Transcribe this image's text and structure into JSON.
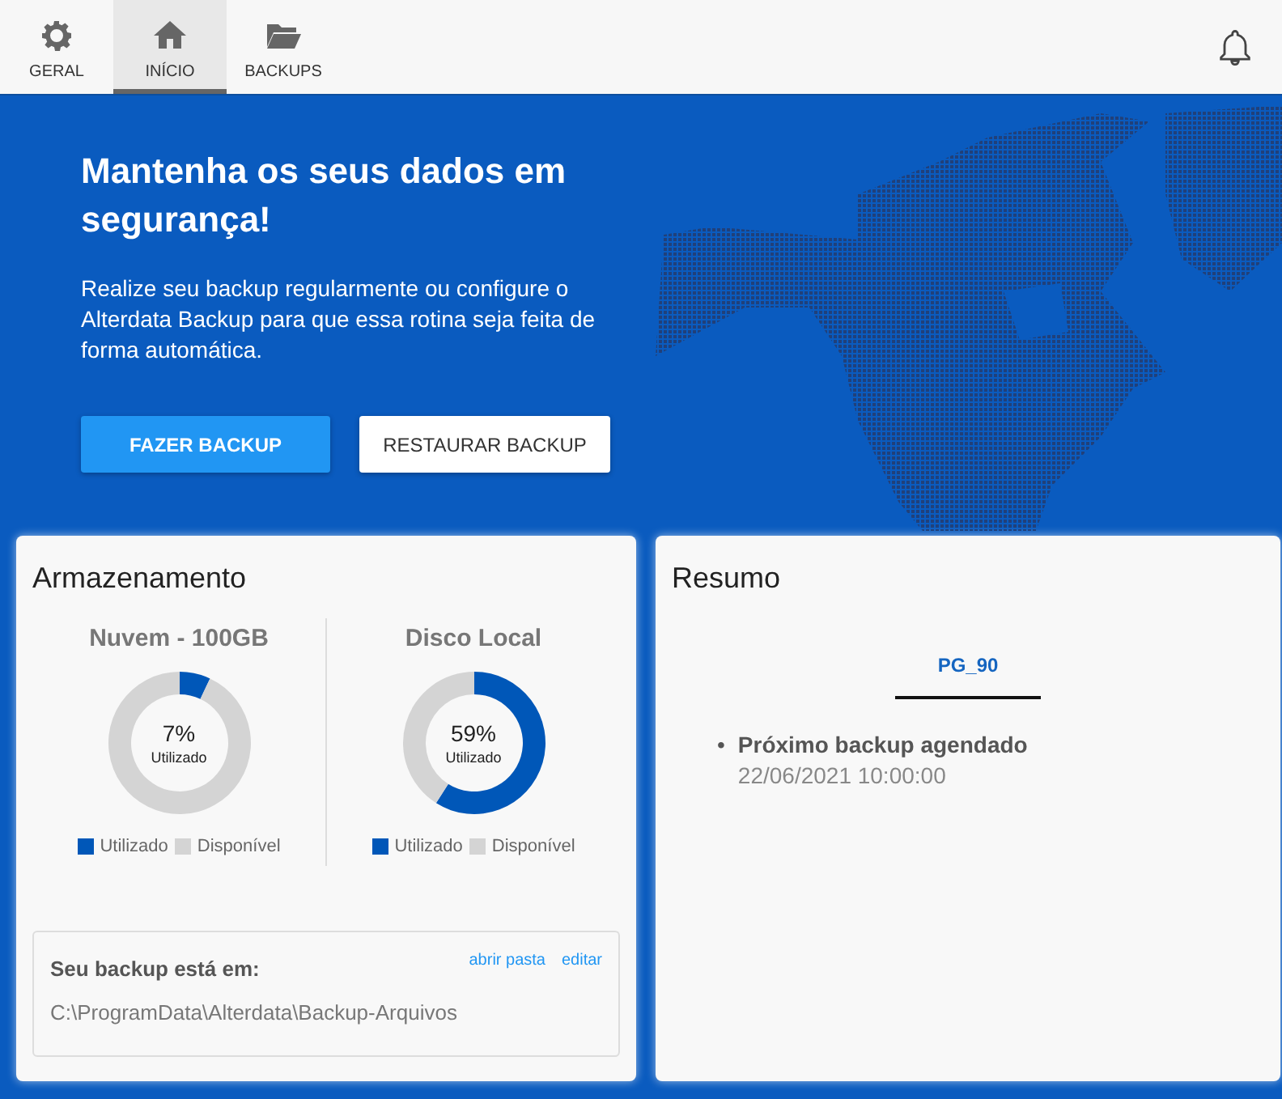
{
  "tabs": [
    {
      "label": "GERAL",
      "selected": false
    },
    {
      "label": "INÍCIO",
      "selected": true
    },
    {
      "label": "BACKUPS",
      "selected": false
    }
  ],
  "hero": {
    "title": "Mantenha os seus dados em segurança!",
    "text": "Realize seu backup regularmente ou configure o Alterdata Backup para que essa rotina seja feita de forma automática.",
    "buttons": [
      {
        "label": "FAZER BACKUP",
        "kind": "primary"
      },
      {
        "label": "RESTAURAR BACKUP",
        "kind": "secondary"
      }
    ]
  },
  "storage": {
    "title": "Armazenamento",
    "disks": [
      {
        "name": "Nuvem - 100GB",
        "percent": "7%",
        "caption": "Utilizado",
        "chart_data": {
          "type": "donut",
          "categories": [
            "Utilizado",
            "Disponível"
          ],
          "values": [
            7,
            93
          ]
        }
      },
      {
        "name": "Disco Local",
        "percent": "59%",
        "caption": "Utilizado",
        "chart_data": {
          "type": "donut",
          "categories": [
            "Utilizado",
            "Disponível"
          ],
          "values": [
            59,
            41
          ]
        }
      }
    ],
    "location": {
      "label": "Seu backup está em:",
      "links": [
        "abrir pasta",
        "editar"
      ],
      "path": "C:\\ProgramData\\Alterdata\\Backup-Arquivos"
    }
  },
  "summary": {
    "title": "Resumo",
    "tabs": [
      {
        "label": "PG_90",
        "selected": true
      }
    ],
    "items": [
      {
        "bullet": "•",
        "title": "Próximo backup agendado",
        "value": "22/06/2021 10:00:00"
      }
    ]
  }
}
